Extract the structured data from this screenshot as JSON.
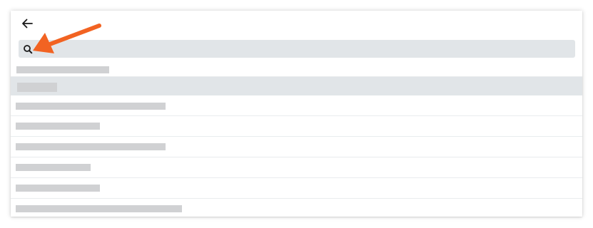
{
  "header": {
    "back_icon": "arrow-left-icon"
  },
  "search": {
    "icon": "search-icon",
    "value": "",
    "placeholder": ""
  },
  "results": {
    "count": 8,
    "selected_index": 1,
    "text_redacted": true
  },
  "annotation": {
    "type": "callout-arrow",
    "color": "#f26322",
    "points_to": "search-icon"
  }
}
